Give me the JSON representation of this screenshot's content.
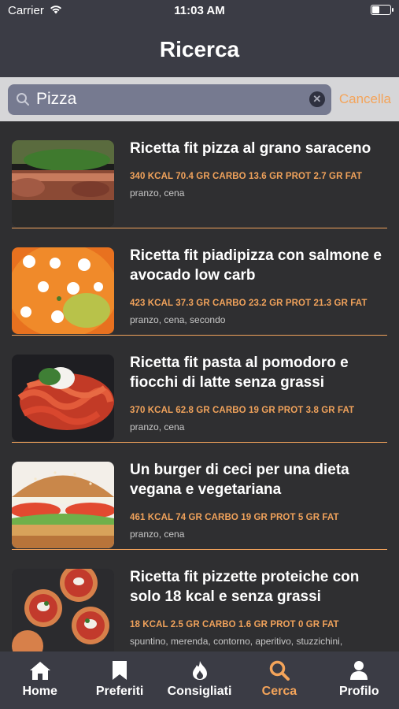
{
  "status_bar": {
    "carrier": "Carrier",
    "time": "11:03 AM",
    "battery_level": 0.45
  },
  "header": {
    "title": "Ricerca"
  },
  "search": {
    "value": "Pizza",
    "cancel_label": "Cancella"
  },
  "results": [
    {
      "title": "Ricetta fit pizza al grano saraceno",
      "macros": "340 KCAL 70.4 GR CARBO 13.6 GR PROT 2.7 GR FAT",
      "tags": "pranzo, cena"
    },
    {
      "title": "Ricetta fit piadipizza con salmone e avocado low carb",
      "macros": "423 KCAL 37.3 GR CARBO 23.2 GR PROT 21.3 GR FAT",
      "tags": "pranzo, cena, secondo"
    },
    {
      "title": "Ricetta fit pasta al pomodoro e fiocchi di latte senza grassi",
      "macros": "370 KCAL 62.8 GR CARBO 19 GR PROT 3.8 GR FAT",
      "tags": "pranzo, cena"
    },
    {
      "title": "Un burger di ceci per una dieta vegana e vegetariana",
      "macros": "461 KCAL 74 GR CARBO 19 GR PROT 5 GR FAT",
      "tags": "pranzo, cena"
    },
    {
      "title": "Ricetta fit pizzette proteiche con solo 18 kcal e senza grassi",
      "macros": "18 KCAL 2.5 GR CARBO 1.6 GR PROT 0 GR FAT",
      "tags": "spuntino, merenda, contorno, aperitivo, stuzzichini,"
    }
  ],
  "tabs": [
    {
      "label": "Home",
      "icon": "home-icon"
    },
    {
      "label": "Preferiti",
      "icon": "bookmark-icon"
    },
    {
      "label": "Consigliati",
      "icon": "flame-icon"
    },
    {
      "label": "Cerca",
      "icon": "search-icon"
    },
    {
      "label": "Profilo",
      "icon": "person-icon"
    }
  ],
  "colors": {
    "accent": "#f4a45a",
    "background": "#2f2f31",
    "bar": "#3b3c45"
  }
}
